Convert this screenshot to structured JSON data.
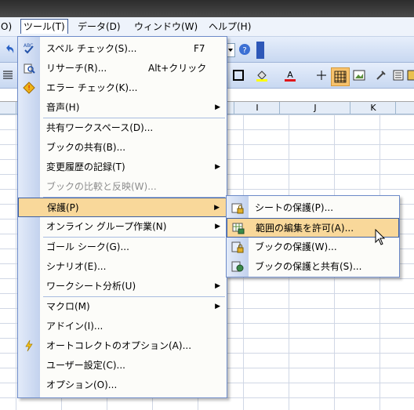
{
  "menubar": {
    "items": [
      "O)",
      "ツール(T)",
      "データ(D)",
      "ウィンドウ(W)",
      "ヘルプ(H)"
    ]
  },
  "columns": [
    "I",
    "J",
    "K"
  ],
  "tools_menu": {
    "items": [
      {
        "label": "スペル チェック(S)...",
        "shortcut": "F7",
        "icon": "spellcheck-icon"
      },
      {
        "label": "リサーチ(R)...",
        "shortcut": "Alt+クリック",
        "icon": "research-icon"
      },
      {
        "label": "エラー チェック(K)...",
        "icon": "error-check-icon"
      },
      {
        "label": "音声(H)",
        "submenu": true
      },
      {
        "label": "共有ワークスペース(D)..."
      },
      {
        "label": "ブックの共有(B)..."
      },
      {
        "label": "変更履歴の記録(T)",
        "submenu": true
      },
      {
        "label": "ブックの比較と反映(W)...",
        "disabled": true
      },
      {
        "label": "保護(P)",
        "submenu": true,
        "highlighted": true
      },
      {
        "label": "オンライン グループ作業(N)",
        "submenu": true
      },
      {
        "label": "ゴール シーク(G)..."
      },
      {
        "label": "シナリオ(E)..."
      },
      {
        "label": "ワークシート分析(U)",
        "submenu": true
      },
      {
        "label": "マクロ(M)",
        "submenu": true
      },
      {
        "label": "アドイン(I)..."
      },
      {
        "label": "オートコレクトのオプション(A)...",
        "icon": "autocorrect-icon"
      },
      {
        "label": "ユーザー設定(C)..."
      },
      {
        "label": "オプション(O)..."
      }
    ]
  },
  "protection_submenu": {
    "items": [
      {
        "label": "シートの保護(P)...",
        "icon": "protect-sheet-icon"
      },
      {
        "label": "範囲の編集を許可(A)...",
        "icon": "allow-edit-range-icon",
        "highlighted": true
      },
      {
        "label": "ブックの保護(W)...",
        "icon": "protect-workbook-icon"
      },
      {
        "label": "ブックの保護と共有(S)...",
        "icon": "protect-share-workbook-icon"
      }
    ]
  }
}
